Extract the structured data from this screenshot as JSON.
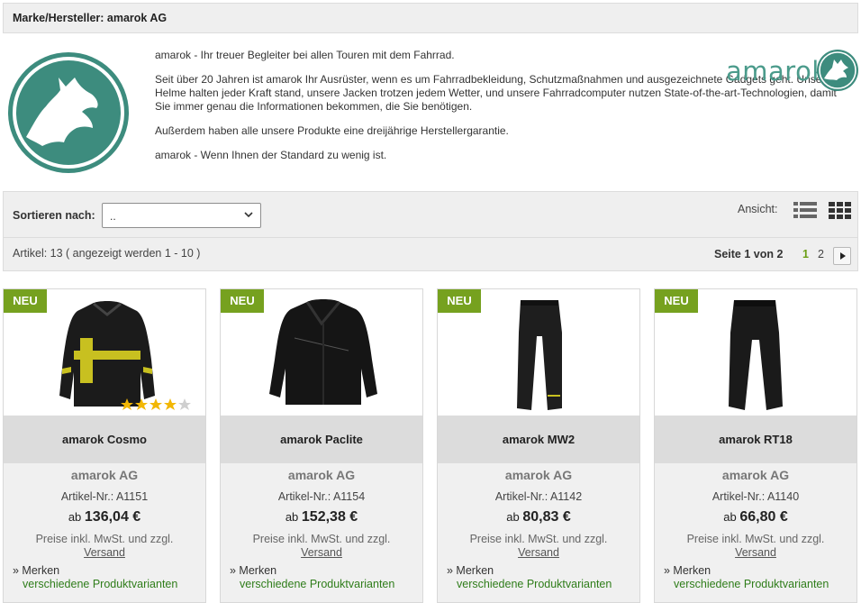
{
  "header": {
    "title": "Marke/Hersteller: amarok AG"
  },
  "intro": {
    "paragraphs": [
      "amarok - Ihr treuer Begleiter bei allen Touren mit dem Fahrrad.",
      "Seit über 20 Jahren ist amarok Ihr Ausrüster, wenn es um Fahrradbekleidung, Schutzmaßnahmen und ausgezeichnete Gadgets geht. Unsere Helme halten jeder Kraft stand, unsere Jacken trotzen jedem Wetter, und unsere Fahrradcomputer nutzen State-of-the-art-Technologien, damit Sie immer genau die Informationen bekommen, die Sie benötigen.",
      "Außerdem haben alle unsere Produkte eine dreijährige Herstellergarantie.",
      "amarok - Wenn Ihnen der Standard zu wenig ist."
    ],
    "brand_text": "amarok"
  },
  "sort": {
    "label": "Sortieren nach:",
    "value": ".."
  },
  "view": {
    "label": "Ansicht:"
  },
  "listing": {
    "count_text": "Artikel: 13 ( angezeigt werden 1 - 10 )",
    "page_label": "Seite 1 von 2",
    "pages": [
      "1",
      "2"
    ]
  },
  "products": [
    {
      "badge": "NEU",
      "name": "amarok Cosmo",
      "maker": "amarok AG",
      "artnr": "Artikel-Nr.: A1151",
      "price_prefix": "ab",
      "price": "136,04 €",
      "tax": "Preise inkl. MwSt. und zzgl.",
      "shipping": "Versand",
      "merken": "» Merken",
      "variants": "verschiedene Produktvarianten",
      "rating": 4
    },
    {
      "badge": "NEU",
      "name": "amarok Paclite",
      "maker": "amarok AG",
      "artnr": "Artikel-Nr.: A1154",
      "price_prefix": "ab",
      "price": "152,38 €",
      "tax": "Preise inkl. MwSt. und zzgl.",
      "shipping": "Versand",
      "merken": "» Merken",
      "variants": "verschiedene Produktvarianten"
    },
    {
      "badge": "NEU",
      "name": "amarok MW2",
      "maker": "amarok AG",
      "artnr": "Artikel-Nr.: A1142",
      "price_prefix": "ab",
      "price": "80,83 €",
      "tax": "Preise inkl. MwSt. und zzgl.",
      "shipping": "Versand",
      "merken": "» Merken",
      "variants": "verschiedene Produktvarianten"
    },
    {
      "badge": "NEU",
      "name": "amarok RT18",
      "maker": "amarok AG",
      "artnr": "Artikel-Nr.: A1140",
      "price_prefix": "ab",
      "price": "66,80 €",
      "tax": "Preise inkl. MwSt. und zzgl.",
      "shipping": "Versand",
      "merken": "» Merken",
      "variants": "verschiedene Produktvarianten"
    }
  ],
  "colors": {
    "brand_teal": "#3f8f80",
    "badge_green": "#76a11f",
    "variant_green": "#2f7d1a",
    "star_gold": "#f2b705"
  }
}
